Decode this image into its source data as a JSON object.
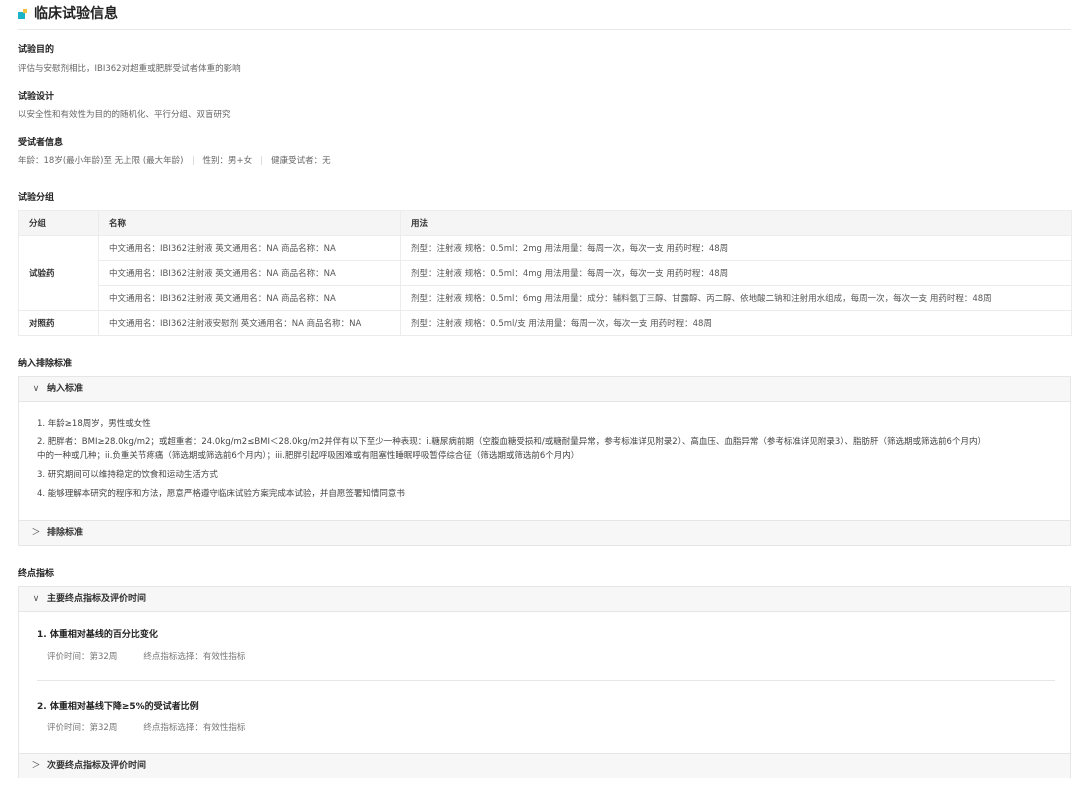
{
  "header": {
    "title": "临床试验信息"
  },
  "objective": {
    "label": "试验目的",
    "text": "评估与安慰剂相比，IBI362对超重或肥胖受试者体重的影响"
  },
  "design": {
    "label": "试验设计",
    "text": "以安全性和有效性为目的的随机化、平行分组、双盲研究"
  },
  "subjects": {
    "label": "受试者信息",
    "age": "年龄：18岁(最小年龄)至 无上限 (最大年龄)",
    "gender": "性别：男+女",
    "healthy": "健康受试者：无"
  },
  "groups": {
    "label": "试验分组",
    "headers": [
      "分组",
      "名称",
      "用法"
    ],
    "rows": [
      {
        "group": "试验药",
        "name": "中文通用名：IBI362注射液 英文通用名：NA 商品名称：NA",
        "usage": "剂型：注射液 规格：0.5ml：2mg 用法用量：每周一次，每次一支 用药时程：48周"
      },
      {
        "group": "",
        "name": "中文通用名：IBI362注射液 英文通用名：NA 商品名称：NA",
        "usage": "剂型：注射液 规格：0.5ml：4mg 用法用量：每周一次，每次一支 用药时程：48周"
      },
      {
        "group": "",
        "name": "中文通用名：IBI362注射液 英文通用名：NA 商品名称：NA",
        "usage": "剂型：注射液 规格：0.5ml：6mg 用法用量：成分：辅料氨丁三醇、甘露醇、丙二醇、依地酸二钠和注射用水组成，每周一次，每次一支 用药时程：48周"
      },
      {
        "group": "对照药",
        "name": "中文通用名：IBI362注射液安慰剂 英文通用名：NA 商品名称：NA",
        "usage": "剂型：注射液 规格：0.5ml/支 用法用量：每周一次，每次一支 用药时程：48周"
      }
    ]
  },
  "criteria": {
    "label": "纳入排除标准",
    "inclusion_title": "纳入标准",
    "inclusion_items": [
      "1. 年龄≥18周岁，男性或女性",
      "2. 肥胖者：BMI≥28.0kg/m2；或超重者：24.0kg/m2≤BMI＜28.0kg/m2并伴有以下至少一种表现：i.糖尿病前期（空腹血糖受损和/或糖耐量异常，参考标准详见附录2）、高血压、血脂异常（参考标准详见附录3）、脂肪肝（筛选期或筛选前6个月内）",
      "中的一种或几种；ii.负重关节疼痛（筛选期或筛选前6个月内）；iii.肥胖引起呼吸困难或有阻塞性睡眠呼吸暂停综合征（筛选期或筛选前6个月内）",
      "3. 研究期间可以维持稳定的饮食和运动生活方式",
      "4. 能够理解本研究的程序和方法，愿意严格遵守临床试验方案完成本试验，并自愿签署知情同意书"
    ],
    "exclusion_title": "排除标准"
  },
  "endpoints": {
    "label": "终点指标",
    "primary_title": "主要终点指标及评价时间",
    "primary_items": [
      {
        "title": "1. 体重相对基线的百分比变化",
        "time": "评价时间：第32周",
        "type": "终点指标选择：有效性指标"
      },
      {
        "title": "2. 体重相对基线下降≥5%的受试者比例",
        "time": "评价时间：第32周",
        "type": "终点指标选择：有效性指标"
      }
    ],
    "secondary_title": "次要终点指标及评价时间"
  },
  "icons": {
    "expanded": "∨",
    "collapsed": "＞"
  },
  "colors": {
    "accent_teal": "#1ab3c8",
    "accent_yellow": "#f3c242"
  }
}
